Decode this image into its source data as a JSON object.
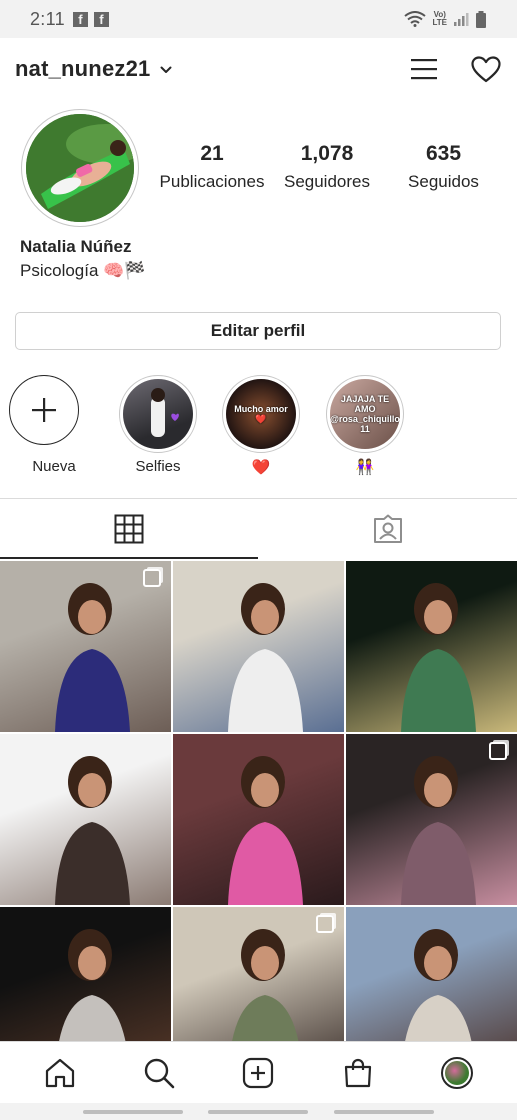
{
  "status_bar": {
    "time": "2:11",
    "notif_icons": [
      "facebook-icon",
      "facebook-icon"
    ],
    "network_label_top": "Vo)",
    "network_label_bottom": "LTE"
  },
  "header": {
    "username": "nat_nunez21",
    "icons": [
      "chevron-down-icon",
      "menu-icon",
      "heart-icon"
    ]
  },
  "profile": {
    "name": "Natalia Núñez",
    "bio": "Psicología 🧠🏁",
    "stats": [
      {
        "value": "21",
        "label": "Publicaciones"
      },
      {
        "value": "1,078",
        "label": "Seguidores"
      },
      {
        "value": "635",
        "label": "Seguidos"
      }
    ],
    "edit_label": "Editar perfil"
  },
  "highlights": [
    {
      "label": "Nueva",
      "text": ""
    },
    {
      "label": "Selfies",
      "text": ""
    },
    {
      "label": "❤️",
      "text": "Mucho amor❤️"
    },
    {
      "label": "👭",
      "text": "JAJAJA TE AMO @rosa_chiquillo 11"
    }
  ],
  "tabs": {
    "icons": [
      "grid-icon",
      "tagged-icon"
    ],
    "active": "grid"
  },
  "grid": {
    "tiles": [
      {
        "multiple": true,
        "colors": [
          "#b5b0a8",
          "#2c2c7a",
          "#6d5e56"
        ]
      },
      {
        "multiple": false,
        "colors": [
          "#d8d3c8",
          "#eeeeee",
          "#5a6f93"
        ]
      },
      {
        "multiple": false,
        "colors": [
          "#0f1a12",
          "#3f7a52",
          "#c9b87a"
        ]
      },
      {
        "multiple": false,
        "colors": [
          "#f3f3f3",
          "#3b2e2a",
          "#8a7a72"
        ]
      },
      {
        "multiple": false,
        "colors": [
          "#6a3a3c",
          "#e05aa4",
          "#2a1a1c"
        ]
      },
      {
        "multiple": true,
        "colors": [
          "#2a2424",
          "#7f5c6a",
          "#c78ea0"
        ]
      },
      {
        "multiple": false,
        "colors": [
          "#111111",
          "#c4c0bc",
          "#5a3a2a"
        ]
      },
      {
        "multiple": true,
        "colors": [
          "#cfc7b8",
          "#6e7c5a",
          "#3a2e2a"
        ]
      },
      {
        "multiple": false,
        "colors": [
          "#8aa0bc",
          "#d7d0c6",
          "#4a3028"
        ]
      }
    ]
  },
  "bottom_nav": {
    "icons": [
      "home-icon",
      "search-icon",
      "new-post-icon",
      "shop-icon",
      "profile-avatar"
    ]
  }
}
